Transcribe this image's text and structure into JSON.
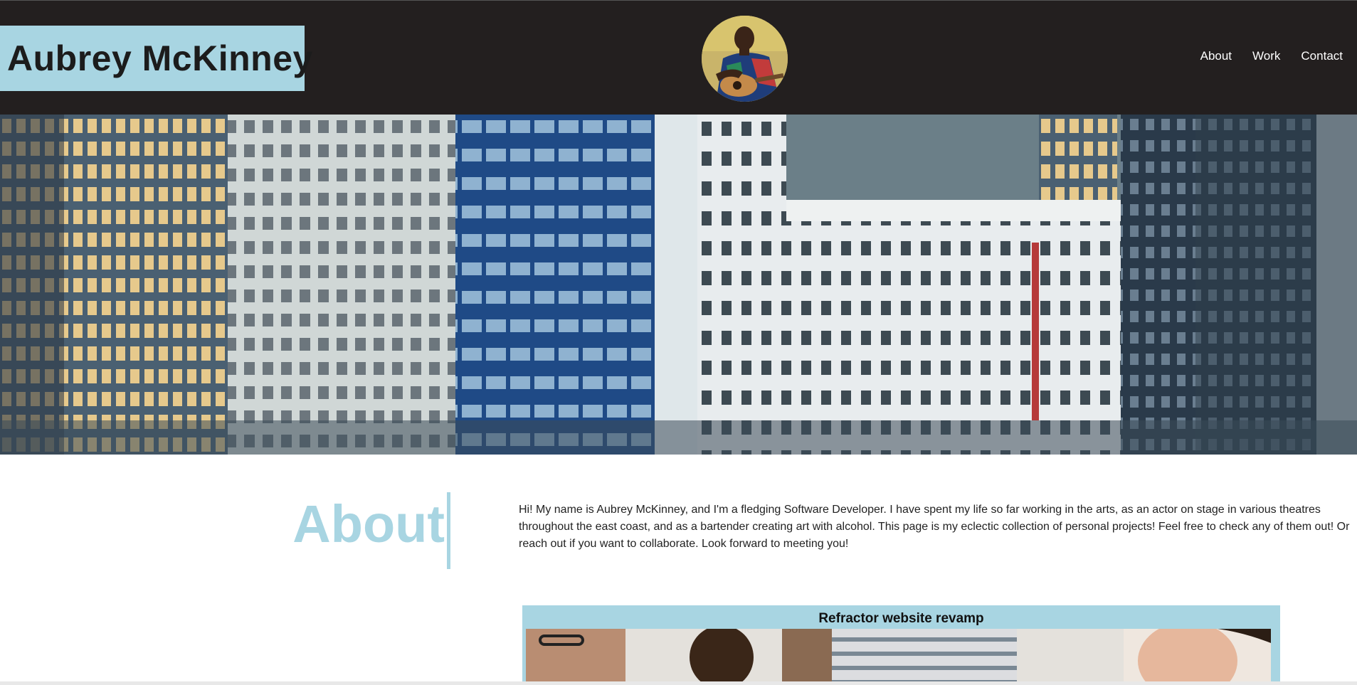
{
  "header": {
    "brand_name": "Aubrey McKinney",
    "nav": [
      {
        "label": "About"
      },
      {
        "label": "Work"
      },
      {
        "label": "Contact"
      }
    ]
  },
  "about": {
    "heading": "About",
    "text": "Hi! My name is Aubrey McKinney, and I'm a fledging Software Developer. I have spent my life so far working in the arts, as an actor on stage in various theatres throughout the east coast, and as a bartender creating art with alcohol. This page is my eclectic collection of personal projects! Feel free to check any of them out! Or reach out if you want to collaborate. Look forward to meeting you!"
  },
  "projects": [
    {
      "title": "Refractor website revamp"
    }
  ],
  "colors": {
    "header_bg": "#231f1f",
    "accent": "#a8d5e2",
    "nav_text": "#ffffff"
  }
}
